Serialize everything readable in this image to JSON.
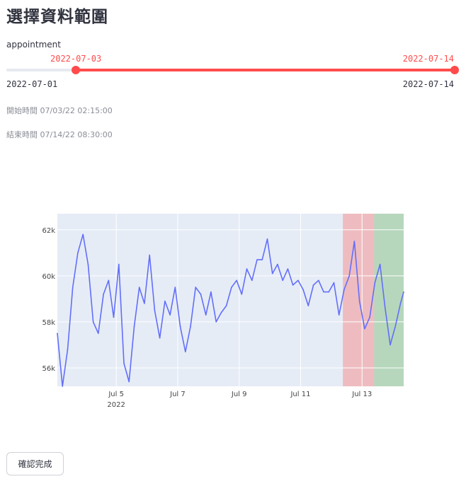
{
  "page": {
    "title": "選擇資料範圍"
  },
  "slider": {
    "label": "appointment",
    "value_start": "2022-07-03",
    "value_end": "2022-07-14",
    "min": "2022-07-01",
    "max": "2022-07-14",
    "accent": "#ff4b4b"
  },
  "info": {
    "start_time": "開始時間 07/03/22 02:15:00",
    "end_time": "結束時間 07/14/22 08:30:00"
  },
  "chart_data": {
    "type": "line",
    "x_range": [
      "2022-07-03 02:00",
      "2022-07-14 08:30"
    ],
    "y_range": [
      55200,
      62700
    ],
    "y_ticks": [
      "56k",
      "58k",
      "60k",
      "62k"
    ],
    "y_tick_values": [
      56000,
      58000,
      60000,
      62000
    ],
    "x_ticks": [
      "Jul 5",
      "Jul 7",
      "Jul 9",
      "Jul 11",
      "Jul 13"
    ],
    "x_tick_dates": [
      "2022-07-05",
      "2022-07-07",
      "2022-07-09",
      "2022-07-11",
      "2022-07-13"
    ],
    "x_year_label": "2022",
    "grid": true,
    "line_color": "#636efa",
    "highlight_bands": [
      {
        "start": "2022-07-12 09:00",
        "end": "2022-07-13 09:30",
        "color": "#f2a3a3"
      },
      {
        "start": "2022-07-13 09:30",
        "end": "2022-07-14 08:30",
        "color": "#9ccc9c"
      }
    ],
    "series": [
      {
        "x": [
          "2022-07-03 02:00",
          "2022-07-03 06:00",
          "2022-07-03 10:00",
          "2022-07-03 14:00",
          "2022-07-03 18:00",
          "2022-07-03 22:00",
          "2022-07-04 02:00",
          "2022-07-04 06:00",
          "2022-07-04 10:00",
          "2022-07-04 14:00",
          "2022-07-04 18:00",
          "2022-07-04 22:00",
          "2022-07-05 02:00",
          "2022-07-05 06:00",
          "2022-07-05 10:00",
          "2022-07-05 14:00",
          "2022-07-05 18:00",
          "2022-07-05 22:00",
          "2022-07-06 02:00",
          "2022-07-06 06:00",
          "2022-07-06 10:00",
          "2022-07-06 14:00",
          "2022-07-06 18:00",
          "2022-07-06 22:00",
          "2022-07-07 02:00",
          "2022-07-07 06:00",
          "2022-07-07 10:00",
          "2022-07-07 14:00",
          "2022-07-07 18:00",
          "2022-07-07 22:00",
          "2022-07-08 02:00",
          "2022-07-08 06:00",
          "2022-07-08 10:00",
          "2022-07-08 14:00",
          "2022-07-08 18:00",
          "2022-07-08 22:00",
          "2022-07-09 02:00",
          "2022-07-09 06:00",
          "2022-07-09 10:00",
          "2022-07-09 14:00",
          "2022-07-09 18:00",
          "2022-07-09 22:00",
          "2022-07-10 02:00",
          "2022-07-10 06:00",
          "2022-07-10 10:00",
          "2022-07-10 14:00",
          "2022-07-10 18:00",
          "2022-07-10 22:00",
          "2022-07-11 02:00",
          "2022-07-11 06:00",
          "2022-07-11 10:00",
          "2022-07-11 14:00",
          "2022-07-11 18:00",
          "2022-07-11 22:00",
          "2022-07-12 02:00",
          "2022-07-12 06:00",
          "2022-07-12 10:00",
          "2022-07-12 14:00",
          "2022-07-12 18:00",
          "2022-07-12 22:00",
          "2022-07-13 02:00",
          "2022-07-13 06:00",
          "2022-07-13 10:00",
          "2022-07-13 14:00",
          "2022-07-13 18:00",
          "2022-07-13 22:00",
          "2022-07-14 02:00",
          "2022-07-14 06:00",
          "2022-07-14 08:30"
        ],
        "y": [
          57500,
          55200,
          56800,
          59500,
          61000,
          61800,
          60500,
          58000,
          57500,
          59200,
          59800,
          58200,
          60500,
          56200,
          55400,
          57800,
          59500,
          58800,
          60900,
          58500,
          57300,
          58900,
          58300,
          59500,
          57800,
          56700,
          57800,
          59500,
          59200,
          58300,
          59300,
          58000,
          58400,
          58700,
          59500,
          59800,
          59200,
          60300,
          59800,
          60700,
          60700,
          61600,
          60100,
          60500,
          59800,
          60300,
          59600,
          59800,
          59400,
          58700,
          59600,
          59800,
          59300,
          59300,
          59700,
          58300,
          59400,
          60000,
          61500,
          58900,
          57700,
          58200,
          59700,
          60500,
          58600,
          57000,
          57800,
          58800,
          59300
        ]
      }
    ]
  },
  "button": {
    "confirm": "確認完成"
  }
}
